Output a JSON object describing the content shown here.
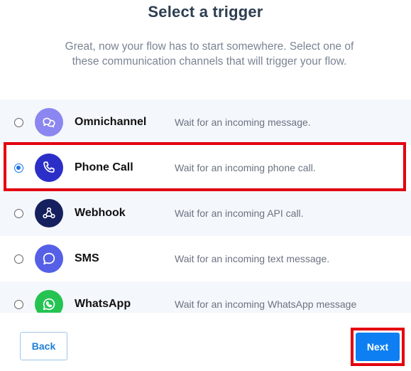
{
  "header": {
    "title": "Select a trigger",
    "subtitle": "Great, now your flow has to start somewhere. Select one of these communication channels that will trigger your flow."
  },
  "triggers": [
    {
      "name": "Omnichannel",
      "description": "Wait for an incoming message.",
      "icon": "chat-bubbles-icon",
      "icon_color": "#8b86f0",
      "selected": false
    },
    {
      "name": "Phone Call",
      "description": "Wait for an incoming phone call.",
      "icon": "phone-icon",
      "icon_color": "#2b2fc7",
      "selected": true
    },
    {
      "name": "Webhook",
      "description": "Wait for an incoming API call.",
      "icon": "webhook-icon",
      "icon_color": "#15205e",
      "selected": false
    },
    {
      "name": "SMS",
      "description": "Wait for an incoming text message.",
      "icon": "message-bubble-icon",
      "icon_color": "#5560e6",
      "selected": false
    },
    {
      "name": "WhatsApp",
      "description": "Wait for an incoming WhatsApp message",
      "icon": "whatsapp-icon",
      "icon_color": "#25c352",
      "selected": false
    }
  ],
  "footer": {
    "back_label": "Back",
    "next_label": "Next"
  },
  "colors": {
    "highlight": "#e3000f",
    "primary": "#0d7ff2",
    "radio_selected": "#1a73e8"
  }
}
